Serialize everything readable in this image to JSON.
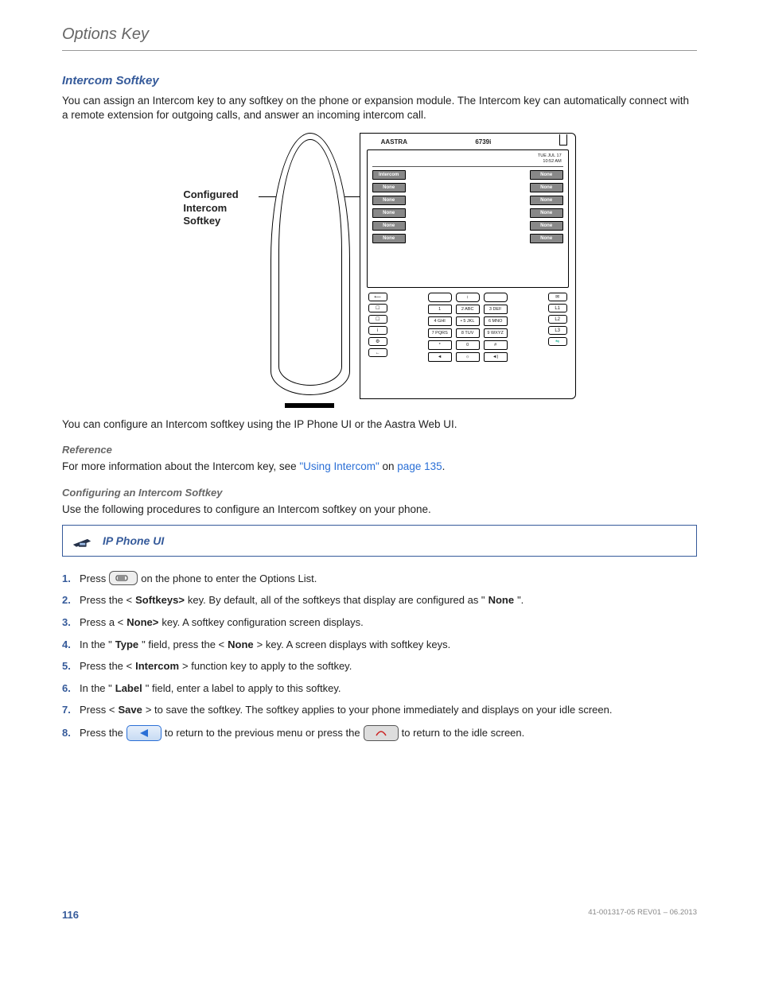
{
  "header": {
    "title": "Options Key"
  },
  "section": {
    "title": "Intercom Softkey",
    "intro": "You can assign an Intercom key to any softkey on the phone or expansion module. The Intercom key can automatically connect with a remote extension for outgoing calls, and answer an incoming intercom call."
  },
  "figure": {
    "callout": "Configured\nIntercom\nSoftkey",
    "brand": "AASTRA",
    "model": "6739i",
    "datetime": "TUE JUL 17\n10:52 AM",
    "left_softkeys": [
      "Intercom",
      "None",
      "None",
      "None",
      "None",
      "None"
    ],
    "right_softkeys": [
      "None",
      "None",
      "None",
      "None",
      "None",
      "None"
    ],
    "dial_keys": [
      "",
      "↕",
      "",
      "1",
      "2 ABC",
      "3 DEF",
      "4 GHI",
      "• 5 JKL",
      "6 MNO",
      "7 PQRS",
      "8 TUV",
      "9 WXYZ",
      "*",
      "0",
      "#",
      "◄",
      "☼",
      "◄)"
    ],
    "fn_left": [
      "⟵",
      "☐",
      "☐",
      "i",
      "⚙",
      "←"
    ],
    "fn_right": [
      "✉",
      "L1",
      "L2",
      "L3"
    ]
  },
  "after_figure": "You can configure an Intercom softkey using the IP Phone UI or the Aastra Web UI.",
  "reference": {
    "heading": "Reference",
    "pre": "For more information about the Intercom key, see ",
    "link1": "\"Using Intercom\"",
    "mid": " on ",
    "link2": "page 135",
    "post": "."
  },
  "configuring": {
    "heading": "Configuring an Intercom Softkey",
    "text": "Use the following procedures to configure an Intercom softkey on your phone."
  },
  "procedure_title": "IP Phone UI",
  "steps": {
    "s1a": "Press",
    "s1b": "on the phone to enter the Options List.",
    "s2a": "Press the <",
    "s2b": "Softkeys>",
    "s2c": " key. By default, all of the softkeys that display are configured as \"",
    "s2d": "None",
    "s2e": "\".",
    "s3a": "Press a <",
    "s3b": "None>",
    "s3c": " key. A softkey configuration screen displays.",
    "s4a": "In the \"",
    "s4b": "Type",
    "s4c": "\" field, press the <",
    "s4d": "None",
    "s4e": "> key. A screen displays with softkey keys.",
    "s5a": "Press the <",
    "s5b": "Intercom",
    "s5c": "> function key to apply to the softkey.",
    "s6a": "In the \"",
    "s6b": "Label",
    "s6c": "\" field, enter a label to apply to this softkey.",
    "s7a": "Press <",
    "s7b": "Save",
    "s7c": "> to save the softkey. The softkey applies to your phone immediately and displays on your idle screen.",
    "s8a": "Press the",
    "s8b": "to return to the previous menu or press the",
    "s8c": "to return to the idle screen."
  },
  "footer": {
    "page": "116",
    "docid": "41-001317-05 REV01 – 06.2013"
  }
}
